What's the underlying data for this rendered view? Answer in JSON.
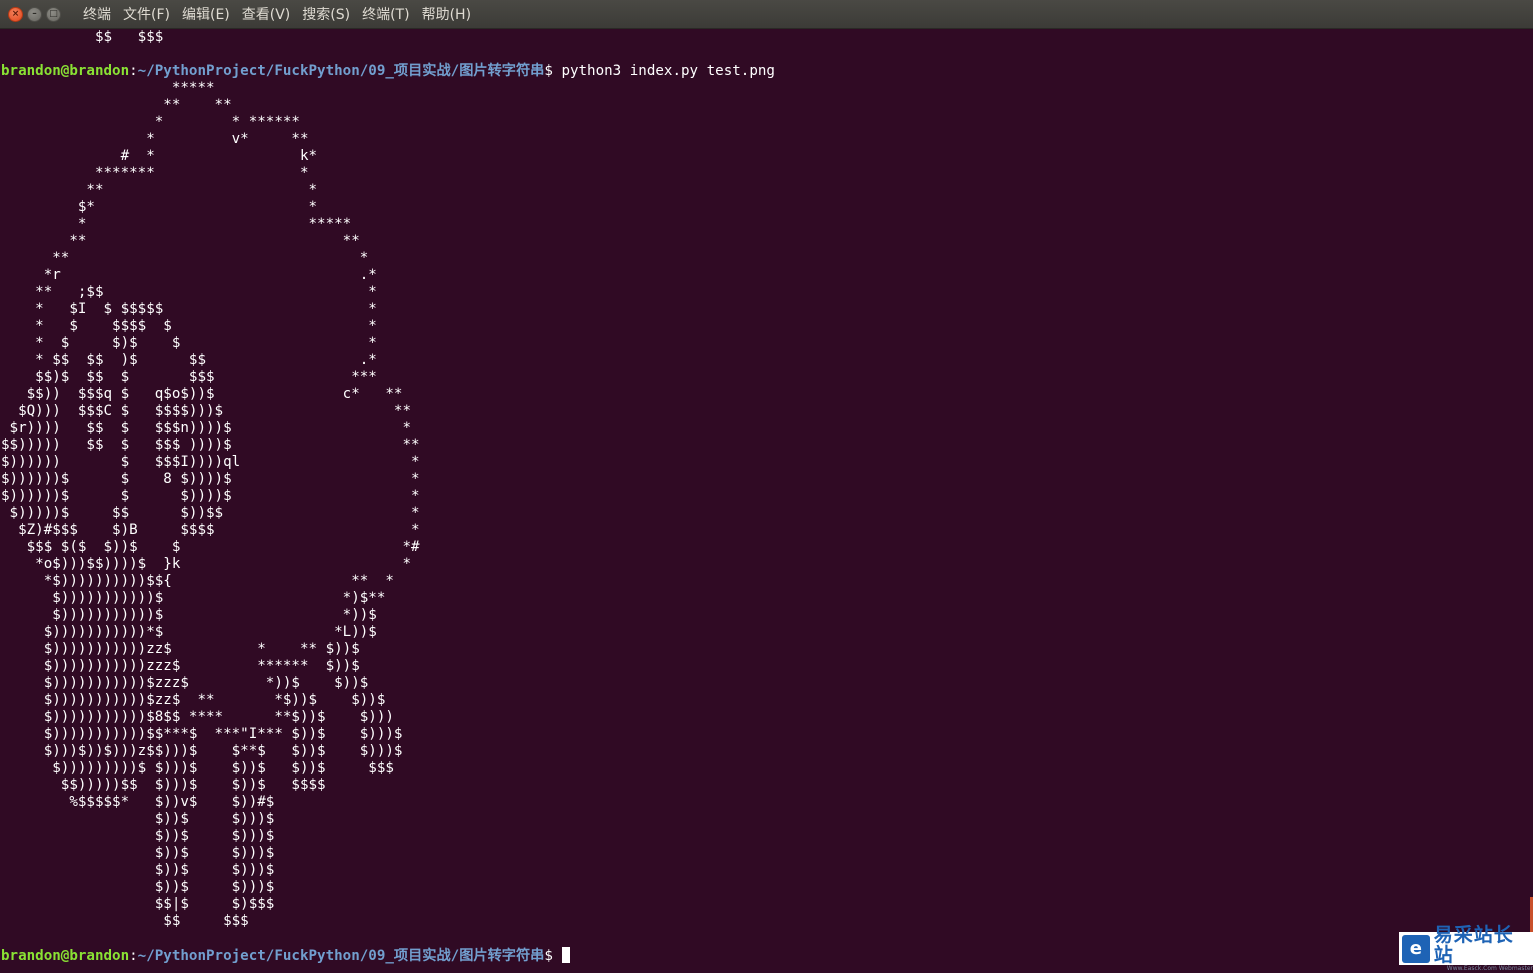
{
  "window": {
    "buttons": {
      "close_glyph": "×",
      "minimize_glyph": "–",
      "maximize_glyph": "□"
    },
    "menu": [
      "终端",
      "文件(F)",
      "编辑(E)",
      "查看(V)",
      "搜索(S)",
      "终端(T)",
      "帮助(H)"
    ]
  },
  "terminal": {
    "colors": {
      "background": "#300a24",
      "text": "#ffffff",
      "user": "#8ae234",
      "path": "#729fcf"
    },
    "previous_output_tail": "           $$   $$$",
    "first_prompt": {
      "user_host": "brandon@brandon",
      "colon": ":",
      "path": "~/PythonProject/FuckPython/09_项目实战/图片转字符串",
      "symbol": "$ ",
      "command": "python3 index.py test.png"
    },
    "art_lines": [
      "                    *****",
      "                   **    **",
      "                  *        * ******",
      "                 *         v*     **",
      "              #  *                 k*",
      "           *******                 *",
      "          **                        *",
      "         $*                         *",
      "         *                          *****",
      "        **                              **",
      "      **                                  *",
      "     *r                                   .*",
      "    **   ;$$                               *",
      "    *   $I  $ $$$$$                        *",
      "    *   $    $$$$  $                       *",
      "    *  $     $)$    $                      *",
      "    * $$  $$  )$      $$                  .*",
      "    $$)$  $$  $       $$$                ***",
      "   $$))  $$$q $   q$o$))$               c*   **",
      "  $Q)))  $$$C $   $$$$)))$                    **",
      " $r))))   $$  $   $$$n))))$                    *",
      "$$)))))   $$  $   $$$ ))))$                    **",
      "$))))))       $   $$$I))))ql                    *",
      "$))))))$      $    8 $))))$                     *",
      "$))))))$      $      $))))$                     *",
      " $)))))$     $$      $))$$                      *",
      "  $Z)#$$$    $)B     $$$$                       *",
      "   $$$ $($  $))$    $                          *#",
      "    *o$)))$$))))$  }k                          *",
      "     *$))))))))))$${                     **  *",
      "      $)))))))))))$                     *)$**",
      "      $)))))))))))$                     *))$",
      "     $)))))))))))*$                    *L))$",
      "     $)))))))))))zz$          *    ** $))$",
      "     $)))))))))))zzz$         ******  $))$",
      "     $)))))))))))$zzz$         *))$    $))$",
      "     $)))))))))))$zz$  **       *$))$    $))$",
      "     $)))))))))))$8$$ ****      **$))$    $)))",
      "     $)))))))))))$$***$  ***\"I*** $))$    $)))$",
      "     $)))$))$)))z$$)))$    $**$   $))$    $)))$",
      "      $)))))))))$ $)))$    $))$   $))$     $$$",
      "       $$)))))$$  $)))$    $))$   $$$$",
      "        %$$$$$*   $))v$    $))#$",
      "                  $))$     $)))$",
      "                  $))$     $)))$",
      "                  $))$     $)))$",
      "                  $))$     $)))$",
      "                  $))$     $)))$",
      "                  $$|$     $)$$$",
      "                   $$     $$$"
    ],
    "last_prompt": {
      "user_host": "brandon@brandon",
      "colon": ":",
      "path": "~/PythonProject/FuckPython/09_项目实战/图片转字符串",
      "symbol": "$ "
    }
  },
  "watermark": {
    "icon": "e-logo-icon",
    "text": "易采站长站",
    "subtext": "Www.Easck.Com  Webmaster"
  }
}
